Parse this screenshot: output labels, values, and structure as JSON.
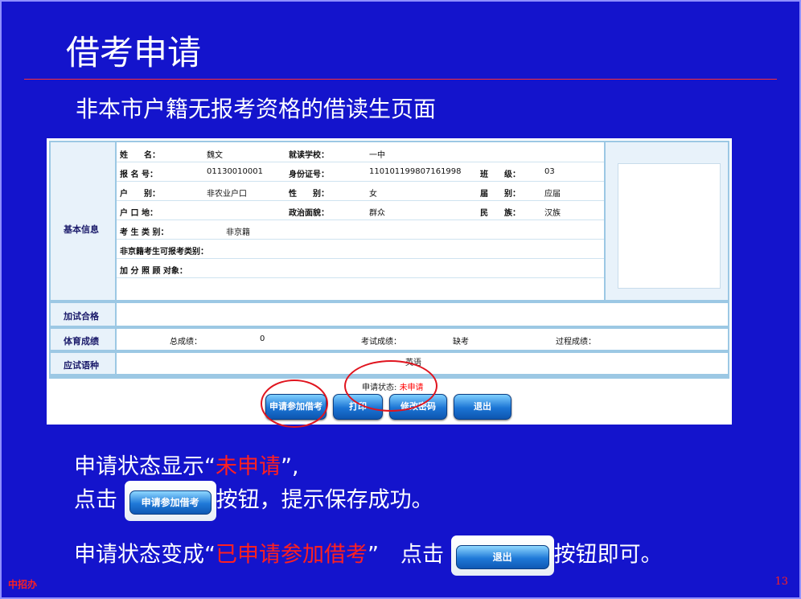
{
  "slide": {
    "title": "借考申请",
    "subtitle": "非本市户籍无报考资格的借读生页面",
    "footer_left": "中招办",
    "page_number": "13"
  },
  "form": {
    "basic_info_label": "基本信息",
    "row1": {
      "name_label": "姓　　名：",
      "name_value": "魏文",
      "school_label": "就读学校：",
      "school_value": "一中"
    },
    "row2": {
      "regno_label": "报 名 号：",
      "regno_value": "01130010001",
      "id_label": "身份证号：",
      "id_value": "110101199807161998",
      "class_label": "班　　级：",
      "class_value": "03"
    },
    "row3": {
      "hukou_type_label": "户　　别：",
      "hukou_type_value": "非农业户口",
      "gender_label": "性　　别：",
      "gender_value": "女",
      "session_label": "届　　别：",
      "session_value": "应届"
    },
    "row4": {
      "hukou_place_label": "户 口 地：",
      "hukou_place_value": "",
      "politics_label": "政治面貌：",
      "politics_value": "群众",
      "ethnicity_label": "民　　族：",
      "ethnicity_value": "汉族"
    },
    "row5": {
      "category_label": "考 生 类 别：",
      "category_value": "非京籍"
    },
    "row6": {
      "nonbj_label": "非京籍考生可报考类别："
    },
    "row7": {
      "bonus_label": "加 分 照 顾 对象："
    },
    "addtest_label": "加试合格",
    "pe_label": "体育成绩",
    "pe": {
      "total_label": "总成绩：",
      "total_value": "0",
      "exam_label": "考试成绩：",
      "exam_value": "缺考",
      "process_label": "过程成绩："
    },
    "lang_label": "应试语种",
    "lang_value": "英语",
    "status_label": "申请状态:",
    "status_value": "未申请"
  },
  "buttons": {
    "apply": "申请参加借考",
    "print": "打印",
    "change_password": "修改密码",
    "exit": "退出"
  },
  "bullets": {
    "b1_prefix": "申请状态显示“",
    "b1_red": "未申请",
    "b1_suffix": "”,",
    "b2_prefix": "点击",
    "b2_button": "申请参加借考",
    "b2_suffix": "按钮，提示保存成功。",
    "b3_prefix": "申请状态变成“",
    "b3_red": "已申请参加借考",
    "b3_mid": "”　点击",
    "b3_button": "退出",
    "b3_suffix": "按钮即可。"
  },
  "colors": {
    "slide_bg": "#1414cc",
    "highlight_red": "#ff2020",
    "form_border": "#9cc8e4"
  }
}
